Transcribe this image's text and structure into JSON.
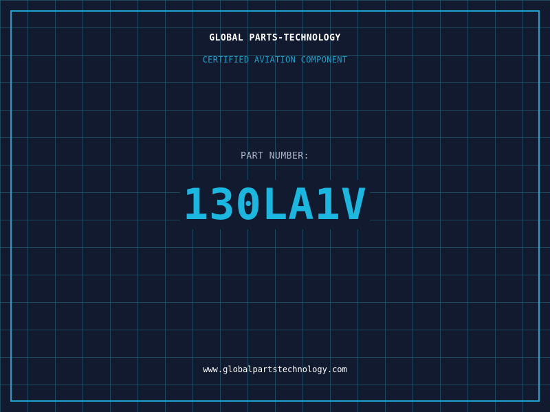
{
  "header": {
    "company_name": "GLOBAL PARTS-TECHNOLOGY",
    "tagline": "CERTIFIED AVIATION COMPONENT"
  },
  "part": {
    "label": "PART NUMBER:",
    "number": "130LA1V"
  },
  "footer": {
    "website": "www.globalpartstechnology.com"
  },
  "colors": {
    "background": "#121a30",
    "grid": "#286e82",
    "accent": "#1aa4cc",
    "part_number": "#1ab8e0",
    "label": "#a9b4c8",
    "text": "#ffffff"
  }
}
